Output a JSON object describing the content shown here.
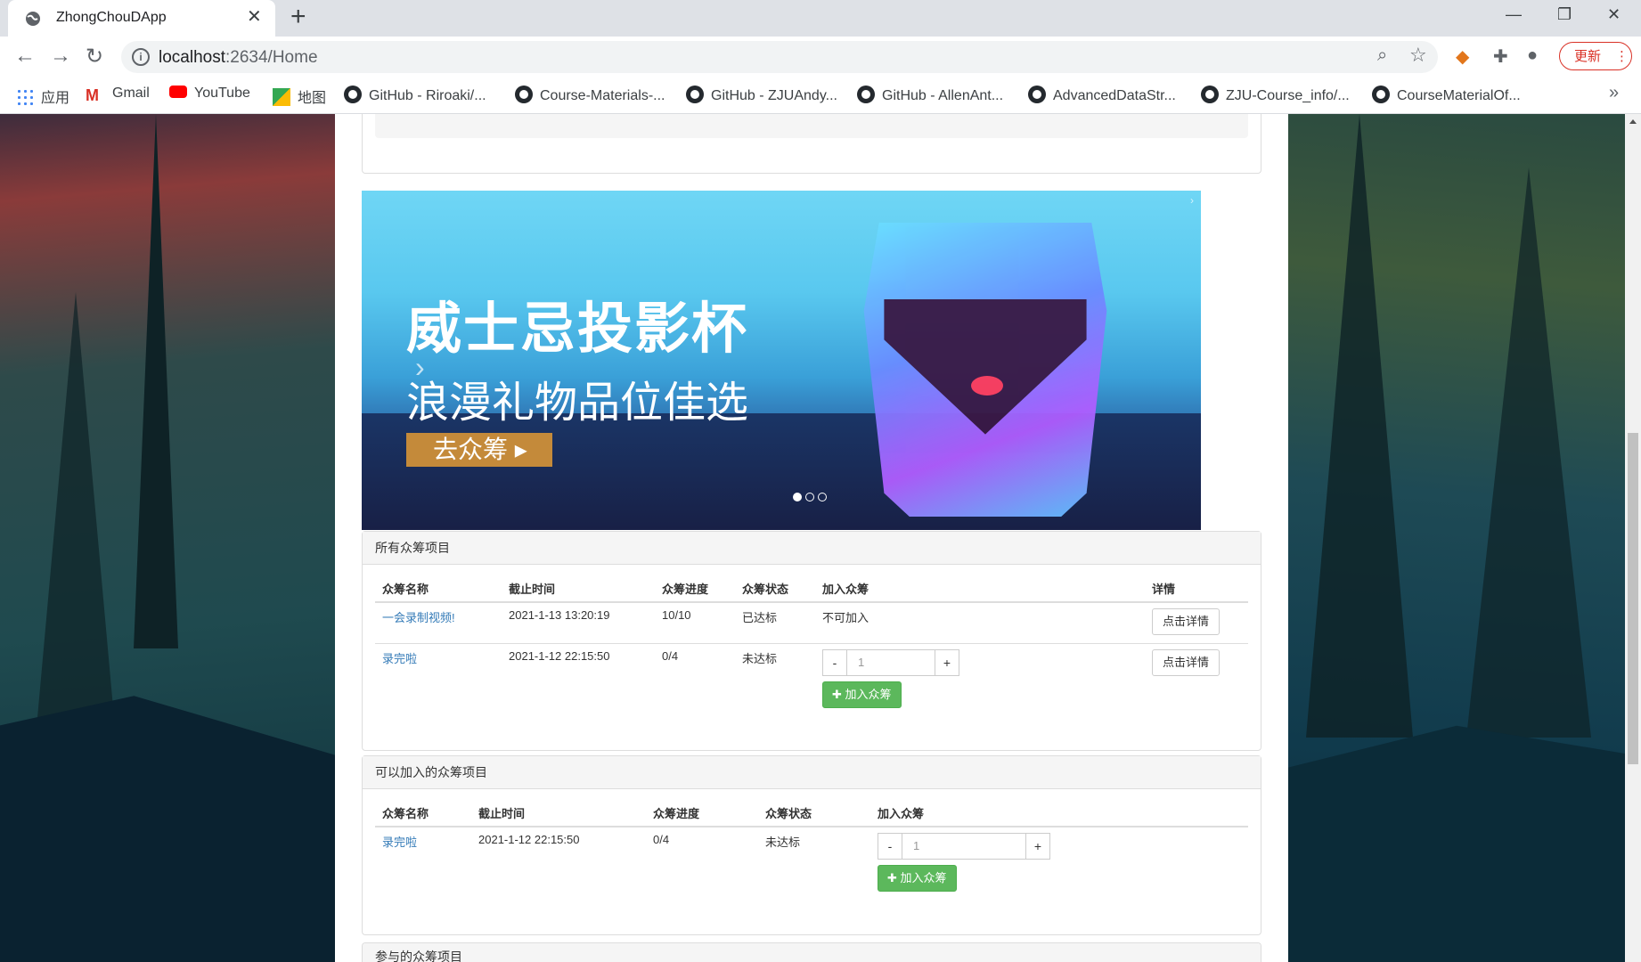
{
  "browser": {
    "tab_title": "ZhongChouDApp",
    "url_host": "localhost",
    "url_path": ":2634/Home",
    "update_label": "更新",
    "bookmarks": [
      {
        "label": "应用",
        "icon": "apps-icon"
      },
      {
        "label": "Gmail",
        "icon": "gmail-icon"
      },
      {
        "label": "YouTube",
        "icon": "youtube-icon"
      },
      {
        "label": "地图",
        "icon": "maps-icon"
      },
      {
        "label": "GitHub - Riroaki/...",
        "icon": "github-icon"
      },
      {
        "label": "Course-Materials-...",
        "icon": "github-icon"
      },
      {
        "label": "GitHub - ZJUAndy...",
        "icon": "github-icon"
      },
      {
        "label": "GitHub - AllenAnt...",
        "icon": "github-icon"
      },
      {
        "label": "AdvancedDataStr...",
        "icon": "github-icon"
      },
      {
        "label": "ZJU-Course_info/...",
        "icon": "github-icon"
      },
      {
        "label": "CourseMaterialOf...",
        "icon": "github-icon"
      }
    ]
  },
  "carousel": {
    "headline": "威士忌投影杯",
    "subline": "浪漫礼物品位佳选",
    "cta": "去众筹",
    "active_index": 0,
    "slide_count": 3
  },
  "all_projects": {
    "heading": "所有众筹项目",
    "columns": [
      "众筹名称",
      "截止时间",
      "众筹进度",
      "众筹状态",
      "加入众筹",
      "详情"
    ],
    "rows": [
      {
        "name": "一会录制视频!",
        "deadline": "2021-1-13 13:20:19",
        "progress": "10/10",
        "status": "已达标",
        "join_text": "不可加入",
        "detail": "点击详情"
      },
      {
        "name": "录完啦",
        "deadline": "2021-1-12 22:15:50",
        "progress": "0/4",
        "status": "未达标",
        "qty": "1",
        "minus": "-",
        "plus": "+",
        "join_btn": "加入众筹",
        "detail": "点击详情"
      }
    ]
  },
  "joinable_projects": {
    "heading": "可以加入的众筹项目",
    "columns": [
      "众筹名称",
      "截止时间",
      "众筹进度",
      "众筹状态",
      "加入众筹"
    ],
    "rows": [
      {
        "name": "录完啦",
        "deadline": "2021-1-12 22:15:50",
        "progress": "0/4",
        "status": "未达标",
        "qty": "1",
        "minus": "-",
        "plus": "+",
        "join_btn": "加入众筹"
      }
    ]
  },
  "participated_projects": {
    "heading": "参与的众筹项目"
  },
  "colors": {
    "success": "#5cb85c",
    "link": "#337ab7",
    "cta": "#c48a3a"
  }
}
